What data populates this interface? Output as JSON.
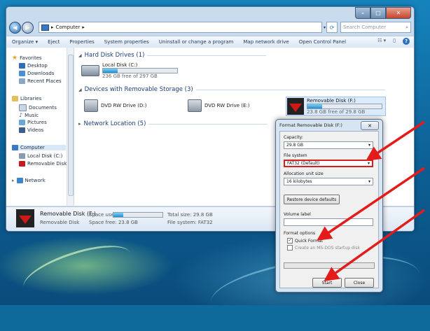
{
  "explorer": {
    "address_path": "Computer",
    "search_placeholder": "Search Computer",
    "toolbar": [
      "Organize ▾",
      "Eject",
      "Properties",
      "System properties",
      "Uninstall or change a program",
      "Map network drive",
      "Open Control Panel"
    ],
    "nav": {
      "favorites": "Favorites",
      "desktop": "Desktop",
      "downloads": "Downloads",
      "recent_places": "Recent Places",
      "libraries": "Libraries",
      "documents": "Documents",
      "music": "Music",
      "pictures": "Pictures",
      "videos": "Videos",
      "computer": "Computer",
      "local_disk": "Local Disk (C:)",
      "removable_disk": "Removable Disk (I",
      "network": "Network"
    },
    "groups": {
      "hdd": "Hard Disk Drives (1)",
      "removable": "Devices with Removable Storage (3)",
      "network": "Network Location (5)"
    },
    "drives": {
      "c_name": "Local Disk (C:)",
      "c_free": "236 GB free of 297 GB",
      "c_used_fraction": 0.2,
      "dvd_d": "DVD RW Drive (D:)",
      "dvd_e": "DVD RW Drive (E:)",
      "f_name": "Removable Disk (F:)",
      "f_free": "23.8 GB free of 29.8 GB",
      "f_used_fraction": 0.2
    },
    "details": {
      "name": "Removable Disk (F:)",
      "type": "Removable Disk",
      "space_used_label": "Space used:",
      "space_free": "Space free: 23.8 GB",
      "total_size": "Total size: 29.8 GB",
      "file_system": "File system: FAT32",
      "used_fraction": 0.2
    }
  },
  "dialog": {
    "title": "Format Removable Disk (F:)",
    "close": "✕",
    "capacity_label": "Capacity:",
    "capacity_value": "29.8 GB",
    "fs_label": "File system",
    "fs_value": "FAT32 (Default)",
    "alloc_label": "Allocation unit size",
    "alloc_value": "16 kilobytes",
    "restore_btn": "Restore device defaults",
    "volume_label": "Volume label",
    "volume_value": "",
    "format_options": "Format options",
    "quick_format": "Quick Format",
    "quick_format_checked": true,
    "msdos": "Create an MS-DOS startup disk",
    "msdos_checked": false,
    "start_btn": "Start",
    "close_btn": "Close"
  },
  "colors": {
    "arrow": "#e31b1b",
    "highlight": "#d62020"
  }
}
